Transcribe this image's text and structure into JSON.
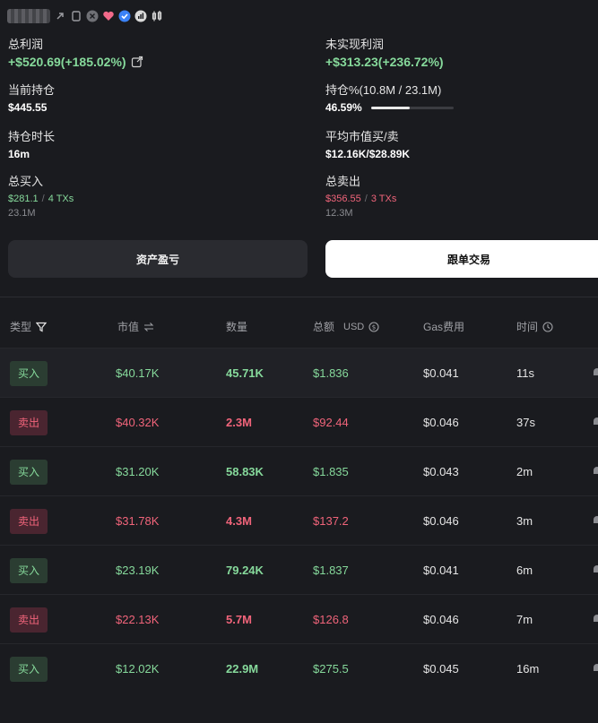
{
  "header": {
    "icons": [
      "copy-icon",
      "page-copy-icon",
      "x-twitter-icon",
      "heart-icon",
      "verified-badge-icon",
      "chart-icon",
      "candlestick-icon"
    ]
  },
  "stats": {
    "total_profit": {
      "label": "总利润",
      "value": "+$520.69(+185.02%)"
    },
    "unrealized_profit": {
      "label": "未实现利润",
      "value": "+$313.23(+236.72%)"
    },
    "current_position": {
      "label": "当前持仓",
      "value": "$445.55"
    },
    "position_pct": {
      "label": "持仓%(10.8M / 23.1M)",
      "value": "46.59%",
      "fill_fraction": 0.4659
    },
    "hold_duration": {
      "label": "持仓时长",
      "value": "16m"
    },
    "avg_mcap": {
      "label": "平均市值买/卖",
      "value": "$12.16K/$28.89K"
    },
    "total_buy": {
      "label": "总买入",
      "amount": "$281.1",
      "sep": "/",
      "txs": "4 TXs",
      "tokens": "23.1M"
    },
    "total_sell": {
      "label": "总卖出",
      "amount": "$356.55",
      "sep": "/",
      "txs": "3 TXs",
      "tokens": "12.3M"
    }
  },
  "buttons": {
    "pnl": "资产盈亏",
    "copy_trade": "跟单交易"
  },
  "table": {
    "headers": {
      "type": "类型",
      "mcap": "市值",
      "qty": "数量",
      "total": "总额",
      "total_unit": "USD",
      "gas": "Gas费用",
      "time": "时间"
    },
    "rows": [
      {
        "type": "买入",
        "side": "buy",
        "mcap": "$40.17K",
        "qty": "45.71K",
        "total": "$1.836",
        "gas": "$0.041",
        "time": "11s"
      },
      {
        "type": "卖出",
        "side": "sell",
        "mcap": "$40.32K",
        "qty": "2.3M",
        "total": "$92.44",
        "gas": "$0.046",
        "time": "37s"
      },
      {
        "type": "买入",
        "side": "buy",
        "mcap": "$31.20K",
        "qty": "58.83K",
        "total": "$1.835",
        "gas": "$0.043",
        "time": "2m"
      },
      {
        "type": "卖出",
        "side": "sell",
        "mcap": "$31.78K",
        "qty": "4.3M",
        "total": "$137.2",
        "gas": "$0.046",
        "time": "3m"
      },
      {
        "type": "买入",
        "side": "buy",
        "mcap": "$23.19K",
        "qty": "79.24K",
        "total": "$1.837",
        "gas": "$0.041",
        "time": "6m"
      },
      {
        "type": "卖出",
        "side": "sell",
        "mcap": "$22.13K",
        "qty": "5.7M",
        "total": "$126.8",
        "gas": "$0.046",
        "time": "7m"
      },
      {
        "type": "买入",
        "side": "buy",
        "mcap": "$12.02K",
        "qty": "22.9M",
        "total": "$275.5",
        "gas": "$0.045",
        "time": "16m"
      }
    ]
  },
  "colors": {
    "background": "#1a1b1f",
    "buy_green": "#86d99b",
    "sell_red": "#f0647a",
    "button_primary": "#ffffff"
  }
}
